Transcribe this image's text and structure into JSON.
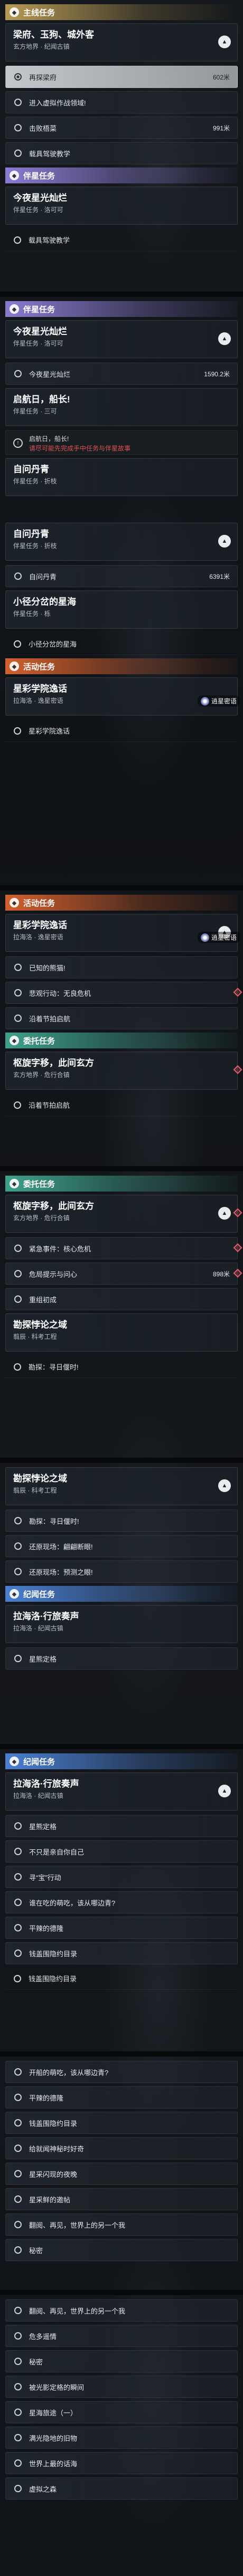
{
  "frames": [
    {
      "blocks": [
        {
          "kind": "section",
          "cls": "s-zhu",
          "icon": "◆",
          "label": "主线任务"
        },
        {
          "kind": "card",
          "h": "tall",
          "title": "梁府、玉狗、城外客",
          "sub": "玄方地界 · 纪闻古镇",
          "caret": "▲"
        },
        {
          "kind": "row",
          "sel": true,
          "label": "再探梁府",
          "dist": "602米"
        },
        {
          "kind": "row",
          "label": "进入虚拟作战领域!"
        },
        {
          "kind": "row",
          "label": "击败梧菜",
          "dist": "991米"
        },
        {
          "kind": "row",
          "label": "载具驾驶教学"
        },
        {
          "kind": "section",
          "cls": "s-ban",
          "icon": "◆",
          "label": "伴星任务"
        },
        {
          "kind": "card",
          "h": "tall",
          "title": "今夜星光灿烂",
          "sub": "伴星任务 · 洛可可"
        },
        {
          "kind": "flat",
          "label": "载具驾驶教学"
        }
      ]
    },
    {
      "blocks": [
        {
          "kind": "section",
          "cls": "s-ban",
          "icon": "◆",
          "label": "伴星任务"
        },
        {
          "kind": "card",
          "h": "tall",
          "title": "今夜星光灿烂",
          "sub": "伴星任务 · 洛可可",
          "caret": "▲"
        },
        {
          "kind": "row",
          "label": "今夜星光灿烂",
          "dist": "1590.2米"
        },
        {
          "kind": "card",
          "h": "tall",
          "title": "启航日，船长!",
          "sub": "伴星任务 · 三可"
        },
        {
          "kind": "warn",
          "l1": "启航日，船长!",
          "l2": "请尽可能先完成手中任务与伴星故事"
        },
        {
          "kind": "card",
          "h": "tall",
          "title": "自问丹青",
          "sub": "伴星任务 · 折枝"
        },
        {
          "kind": "blank",
          "h": 42
        },
        {
          "kind": "card",
          "h": "tall",
          "title": "自问丹青",
          "sub": "伴星任务 · 折枝",
          "caret": "▲"
        },
        {
          "kind": "row",
          "label": "自问丹青",
          "dist": "6391米"
        },
        {
          "kind": "card",
          "h": "tall",
          "title": "小径分岔的星海",
          "sub": "伴星任务 · 栎"
        },
        {
          "kind": "flat",
          "label": "小径分岔的星海"
        },
        {
          "kind": "section",
          "cls": "s-huo",
          "icon": "◆",
          "label": "活动任务"
        },
        {
          "kind": "card",
          "h": "tall",
          "title": "星彩学院逸话",
          "sub": "拉海洛 · 逸星密语",
          "tip": "逍星密语"
        },
        {
          "kind": "flat",
          "label": "星彩学院逸话"
        }
      ]
    },
    {
      "blocks": [
        {
          "kind": "section",
          "cls": "s-huo",
          "icon": "◆",
          "label": "活动任务"
        },
        {
          "kind": "card",
          "h": "tall",
          "title": "星彩学院逸话",
          "sub": "拉海洛 · 逸星密语",
          "caret": "▲",
          "tip": "逍星密语"
        },
        {
          "kind": "row",
          "label": "已知的熊猫!"
        },
        {
          "kind": "row",
          "label": "悲观行动：无良危机",
          "diamond": true
        },
        {
          "kind": "row",
          "label": "沿着节拍启航"
        },
        {
          "kind": "section",
          "cls": "s-mao",
          "icon": "◆",
          "label": "委托任务"
        },
        {
          "kind": "card",
          "h": "tall",
          "title": "枢旋字移，此间玄方",
          "sub": "玄方地界 · 危行合镇",
          "diamond": true
        },
        {
          "kind": "flat",
          "label": "沿着节拍启航"
        }
      ]
    },
    {
      "blocks": [
        {
          "kind": "section",
          "cls": "s-mao",
          "icon": "◆",
          "label": "委托任务"
        },
        {
          "kind": "card",
          "h": "tall",
          "title": "枢旋字移，此间玄方",
          "sub": "玄方地界 · 危行合镇",
          "caret": "▲",
          "diamond": true
        },
        {
          "kind": "row",
          "label": "紧急事件：核心危机",
          "diamond": true
        },
        {
          "kind": "row",
          "label": "危局提示与问心",
          "dist": "898米",
          "diamond": true
        },
        {
          "kind": "row",
          "label": "重组初成"
        },
        {
          "kind": "card",
          "h": "tall",
          "title": "勘探悖论之域",
          "sub": "翦辰 · 科考工程"
        },
        {
          "kind": "flat",
          "label": "勘探：寻日偃时!"
        }
      ]
    },
    {
      "blocks": [
        {
          "kind": "card",
          "h": "tall",
          "title": "勘探悖论之域",
          "sub": "翦辰 · 科考工程",
          "caret": "▲"
        },
        {
          "kind": "row",
          "label": "勘探：寻日偃时!"
        },
        {
          "kind": "row",
          "label": "还原现场：翩翩断眼!"
        },
        {
          "kind": "row",
          "label": "还原现场：预测之眼!"
        },
        {
          "kind": "section",
          "cls": "s-ji",
          "icon": "◆",
          "label": "纪闻任务"
        },
        {
          "kind": "card",
          "h": "tall",
          "title": "拉海洛·行旅奏声",
          "sub": "拉海洛 · 纪闻古镇"
        },
        {
          "kind": "row",
          "label": "星熊定格"
        }
      ]
    },
    {
      "blocks": [
        {
          "kind": "section",
          "cls": "s-ji",
          "icon": "◆",
          "label": "纪闻任务"
        },
        {
          "kind": "card",
          "h": "tall",
          "title": "拉海洛·行旅奏声",
          "sub": "拉海洛 · 纪闻古镇",
          "caret": "▲"
        },
        {
          "kind": "row",
          "label": "星熊定格"
        },
        {
          "kind": "row",
          "label": "不只是亲自你自己"
        },
        {
          "kind": "row",
          "label": "寻“宝”行动"
        },
        {
          "kind": "row",
          "label": "谁在吃的萌吃，该从哪边青?"
        },
        {
          "kind": "row",
          "label": "平辣的德隆"
        },
        {
          "kind": "row",
          "label": "钱盖围隐约目录"
        },
        {
          "kind": "flat",
          "label": "钱盖围隐约目录"
        }
      ]
    },
    {
      "blocks": [
        {
          "kind": "row",
          "label": "开船的萌吃，该从哪边青?"
        },
        {
          "kind": "row",
          "label": "平辣的德隆"
        },
        {
          "kind": "row",
          "label": "钱盖围隐约目录"
        },
        {
          "kind": "row",
          "label": "给就闻神秘时好奇"
        },
        {
          "kind": "row",
          "label": "星采闪现的夜晚"
        },
        {
          "kind": "row",
          "label": "星采鲜的邀帖"
        },
        {
          "kind": "row",
          "label": "翻阅、再见，世界上的另一个我"
        },
        {
          "kind": "row",
          "label": "秘密"
        }
      ]
    },
    {
      "blocks": [
        {
          "kind": "row",
          "label": "翻阅、再见，世界上的另一个我"
        },
        {
          "kind": "row",
          "label": "危多遥情"
        },
        {
          "kind": "row",
          "label": "秘密"
        },
        {
          "kind": "row",
          "label": "被光影定格的瞬间"
        },
        {
          "kind": "row",
          "label": "星海旅途（一）"
        },
        {
          "kind": "row",
          "label": "满光隐地的旧物"
        },
        {
          "kind": "row",
          "label": "世界上最的话海"
        },
        {
          "kind": "row",
          "label": "虚拟之森"
        }
      ]
    }
  ]
}
